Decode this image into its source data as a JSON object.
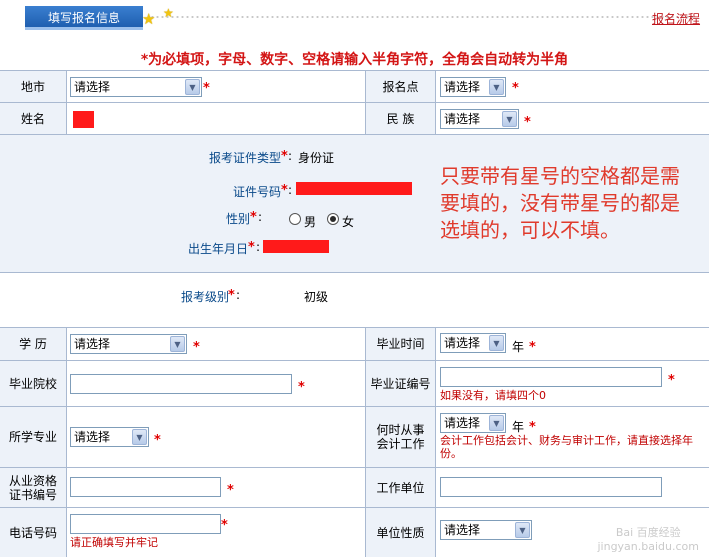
{
  "header": {
    "tab_title": "填写报名信息",
    "flow_link": "报名流程",
    "notice": "*为必填项，字母、数字、空格请输入半角字符，全角会自动转为半角"
  },
  "required_mark": "*",
  "placeholder_select": "请选择",
  "fields": {
    "city_label": "地市",
    "site_label": "报名点",
    "name_label": "姓名",
    "ethnicity_label": "民 族",
    "id_type_label": "报考证件类型",
    "id_type_value": "身份证",
    "id_number_label": "证件号码",
    "gender_label": "性别",
    "gender_male": "男",
    "gender_female": "女",
    "birth_label": "出生年月日",
    "level_label": "报考级别",
    "level_value": "初级",
    "education_label": "学 历",
    "grad_time_label": "毕业时间",
    "year_unit": "年",
    "school_label": "毕业院校",
    "cert_no_label": "毕业证编号",
    "cert_no_hint": "如果没有，请填四个0",
    "major_label": "所学专业",
    "work_since_label_1": "何时从事",
    "work_since_label_2": "会计工作",
    "work_since_hint": "会计工作包括会计、财务与审计工作，请直接选择年份。",
    "qual_label_1": "从业资格",
    "qual_label_2": "证书编号",
    "employer_label": "工作单位",
    "phone_label": "电话号码",
    "phone_hint": "请正确填写并牢记",
    "unit_type_label": "单位性质"
  },
  "annotation": "只要带有星号的空格都是需要填的，没有带星号的都是选填的，可以不填。",
  "watermark": {
    "line1": "Bai 百度经验",
    "line2": "jingyan.baidu.com"
  },
  "colors": {
    "tab_blue": "#2a6cc4",
    "required_red": "#e00000",
    "label_bg": "#edf2f9",
    "annotation_red": "#e03a2c"
  },
  "icons": [
    "star-icon",
    "star-icon",
    "dropdown-arrow-icon",
    "radio-icon"
  ]
}
